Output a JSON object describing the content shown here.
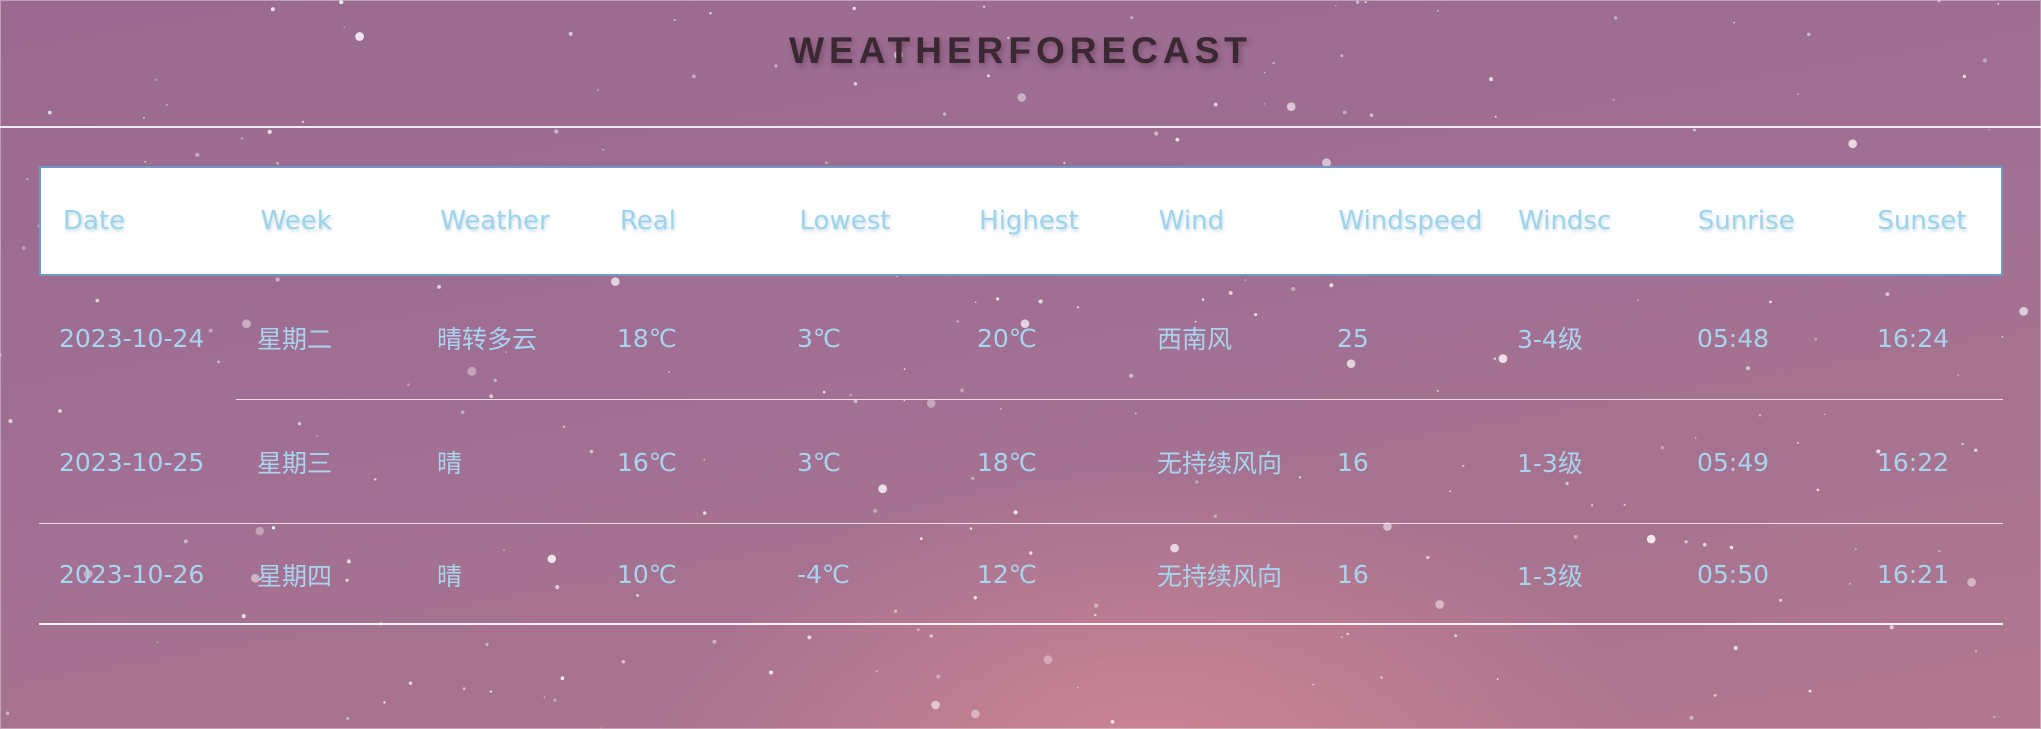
{
  "page": {
    "title": "WEATHERFORECAST"
  },
  "table": {
    "columns": [
      "Date",
      "Week",
      "Weather",
      "Real",
      "Lowest",
      "Highest",
      "Wind",
      "Windspeed",
      "Windsc",
      "Sunrise",
      "Sunset"
    ],
    "rows": [
      [
        "2023-10-24",
        "星期二",
        "晴转多云",
        "18℃",
        "3℃",
        "20℃",
        "西南风",
        "25",
        "3-4级",
        "05:48",
        "16:24"
      ],
      [
        "2023-10-25",
        "星期三",
        "晴",
        "16℃",
        "3℃",
        "18℃",
        "无持续风向",
        "16",
        "1-3级",
        "05:49",
        "16:22"
      ],
      [
        "2023-10-26",
        "星期四",
        "晴",
        "10℃",
        "-4℃",
        "12℃",
        "无持续风向",
        "16",
        "1-3级",
        "05:50",
        "16:21"
      ]
    ]
  },
  "colors": {
    "background": "#a06f93",
    "header_text": "#9ed3ea",
    "cell_text": "#a8d4ef",
    "title_text": "#3a2832",
    "header_border": "#6f9ac8"
  }
}
